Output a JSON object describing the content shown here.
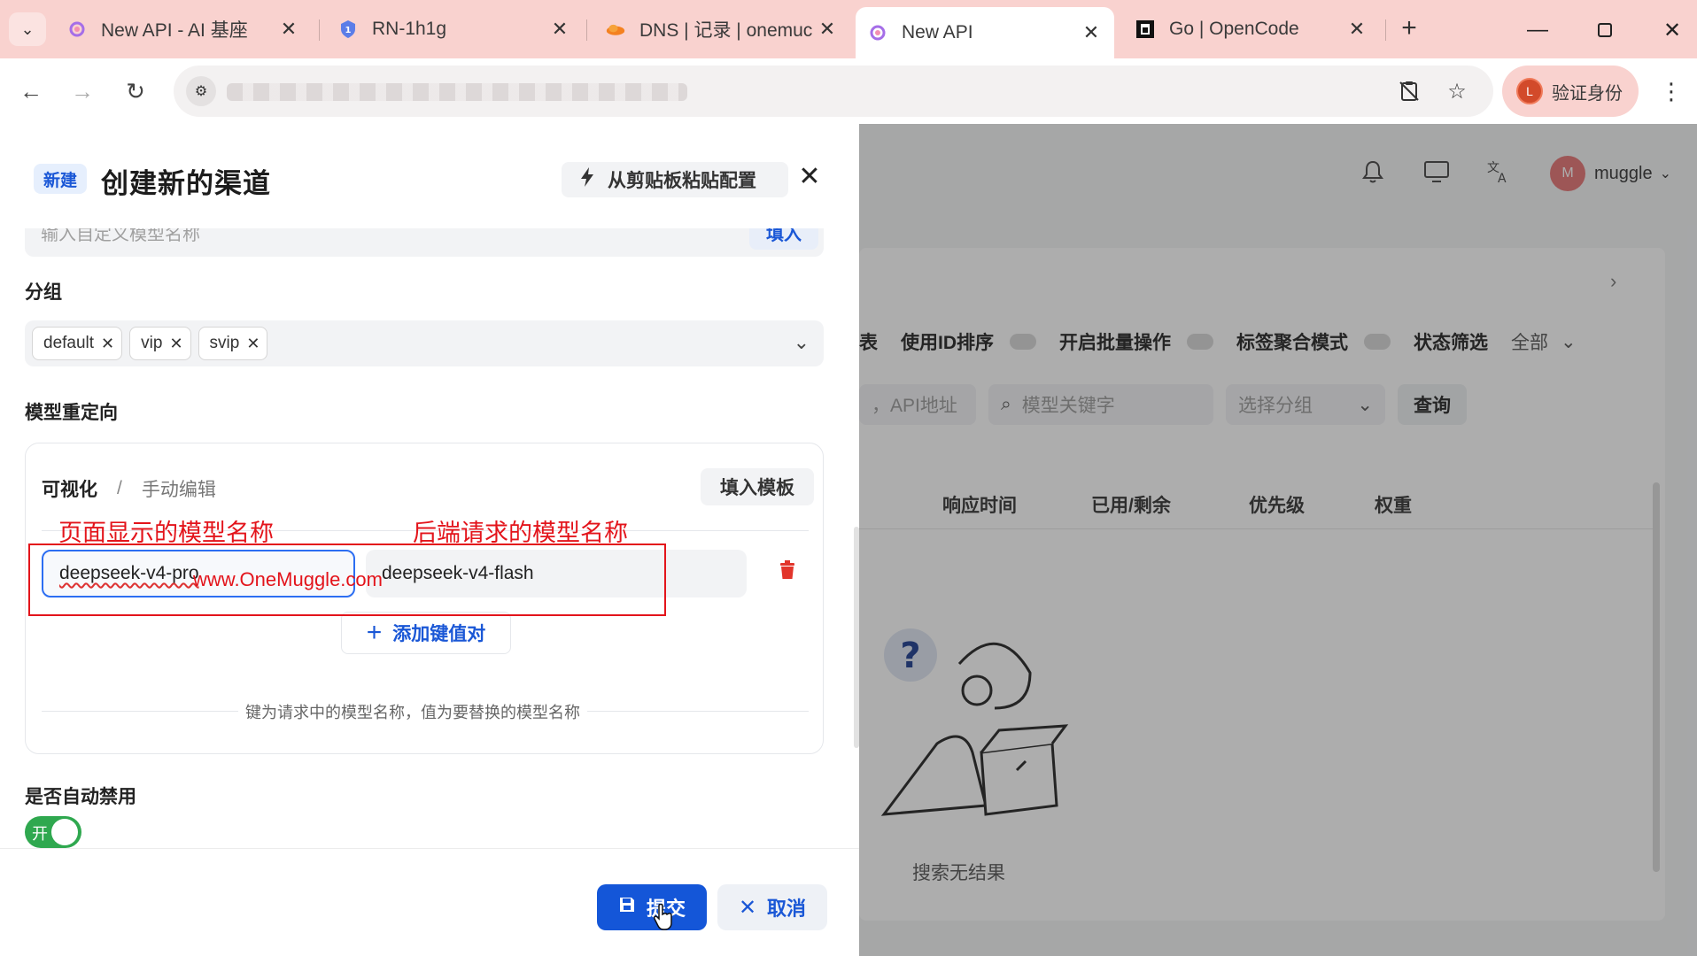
{
  "browser": {
    "tabs": [
      {
        "title": "New API - AI 基座",
        "icon": "newapi-logo-icon"
      },
      {
        "title": "RN-1h1g",
        "icon": "shield-icon"
      },
      {
        "title": "DNS | 记录 | onemuc",
        "icon": "cloudflare-icon"
      },
      {
        "title": "New API",
        "icon": "newapi-logo-icon",
        "active": true
      },
      {
        "title": "Go | OpenCode",
        "icon": "opencode-icon"
      }
    ],
    "verify_label": "验证身份",
    "verify_avatar": "L"
  },
  "sheet": {
    "badge": "新建",
    "title": "创建新的渠道",
    "paste_label": "从剪贴板粘贴配置",
    "custom_model_placeholder": "输入自定义模型名称",
    "custom_model_fill": "填入",
    "group_label": "分组",
    "groups": [
      "default",
      "vip",
      "svip"
    ],
    "redirect_label": "模型重定向",
    "redirect_tab_visual": "可视化",
    "redirect_tab_sep": "/",
    "redirect_tab_manual": "手动编辑",
    "template_button": "填入模板",
    "mapping_key": "deepseek-v4-pro",
    "mapping_value": "deepseek-v4-flash",
    "add_pair_label": "添加键值对",
    "hint": "键为请求中的模型名称，值为要替换的模型名称",
    "auto_disable_label": "是否自动禁用",
    "auto_disable_state": "开",
    "submit_label": "提交",
    "cancel_label": "取消"
  },
  "annotations": {
    "left": "页面显示的模型名称",
    "right": "后端请求的模型名称",
    "watermark": "www.OneMuggle.com",
    "color": "#e3141b"
  },
  "background_app": {
    "username": "muggle",
    "user_initial": "M",
    "filters": [
      {
        "label": "表",
        "toggle": false
      },
      {
        "label": "使用ID排序",
        "toggle": true
      },
      {
        "label": "开启批量操作",
        "toggle": true
      },
      {
        "label": "标签聚合模式",
        "toggle": true
      },
      {
        "label": "状态筛选",
        "toggle": false
      }
    ],
    "status_value": "全部",
    "search_api_placeholder": "，API地址",
    "search_keyword_placeholder": "模型关键字",
    "group_select_placeholder": "选择分组",
    "query_button": "查询",
    "columns": [
      "响应时间",
      "已用/剩余",
      "优先级",
      "权重"
    ],
    "empty_text": "搜索无结果"
  }
}
